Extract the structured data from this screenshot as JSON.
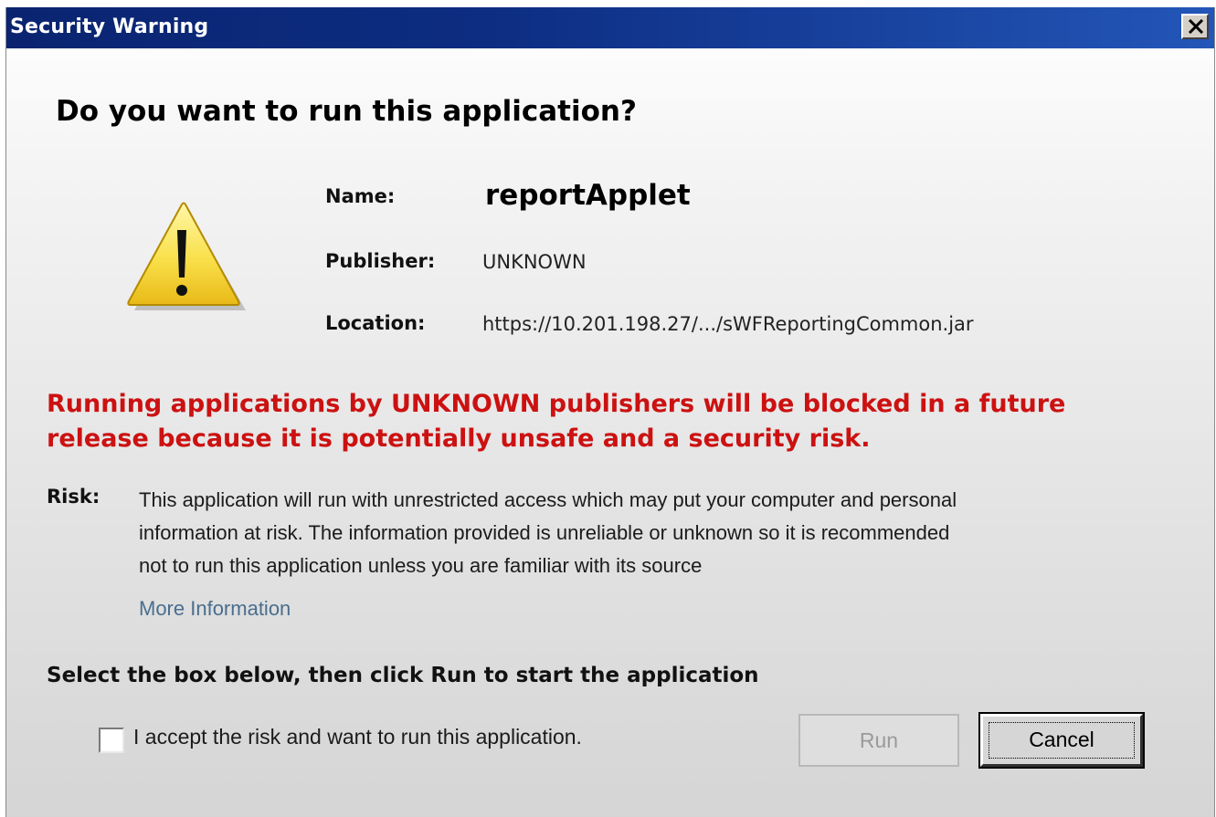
{
  "window": {
    "title": "Security Warning"
  },
  "dialog": {
    "question": "Do you want to run this application?",
    "icon": "warning-triangle-icon",
    "name_label": "Name:",
    "name_value": "reportApplet",
    "publisher_label": "Publisher:",
    "publisher_value": "UNKNOWN",
    "location_label": "Location:",
    "location_value": "https://10.201.198.27/.../sWFReportingCommon.jar",
    "warning_line1": "Running applications by UNKNOWN publishers will be blocked in a future",
    "warning_line2": "release because it is potentially unsafe and a security risk.",
    "risk_label": "Risk:",
    "risk_line1": "This application will run with unrestricted access which may put your computer and personal",
    "risk_line2": "information at risk. The information provided is unreliable or unknown so it is recommended",
    "risk_line3": "not to run this application unless you are familiar with its source",
    "more_info_link": "More Information",
    "select_instruction": "Select the box below, then click Run to start the application",
    "accept_checkbox_label": "I accept the risk and want to run this application.",
    "accept_checked": false,
    "run_button": "Run",
    "run_enabled": false,
    "cancel_button": "Cancel"
  },
  "colors": {
    "warning_red": "#cc1111",
    "title_bar": "#0d2d82",
    "link": "#4a6e8e"
  }
}
